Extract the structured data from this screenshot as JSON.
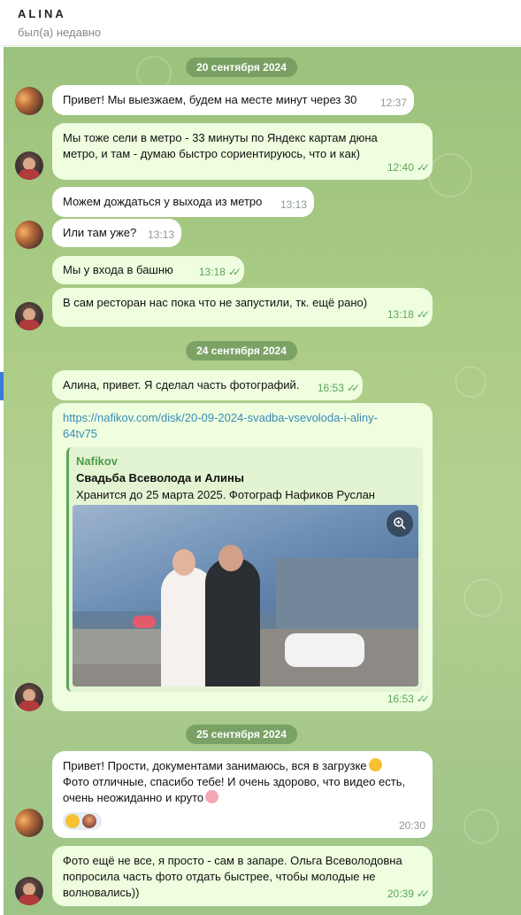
{
  "header": {
    "title": "ALINA",
    "status": "был(а) недавно"
  },
  "dates": [
    "20 сентября 2024",
    "24 сентября 2024",
    "25 сентября 2024"
  ],
  "messages": [
    {
      "text": "Привет! Мы выезжаем, будем на месте минут через  30",
      "time": "12:37"
    },
    {
      "text": "Мы тоже сели в метро - 33 минуты по Яндекс картам дюна метро, и там - думаю быстро сориентируюсь, что и как)",
      "time": "12:40"
    },
    {
      "text": "Можем дождаться у выхода из метро",
      "time": "13:13"
    },
    {
      "text": "Или там уже?",
      "time": "13:13"
    },
    {
      "text": "Мы у входа в башню",
      "time": "13:18"
    },
    {
      "text": "В сам ресторан нас пока что не запустили, тк. ещё рано)",
      "time": "13:18"
    },
    {
      "text": "Алина, привет. Я сделал часть фотографий.",
      "time": "16:53"
    },
    {
      "text": "https://nafikov.com/disk/20-09-2024-svadba-vsevoloda-i-aliny-64tv75",
      "time": "16:53"
    },
    {
      "text": "Привет! Прости, документами занимаюсь, вся в загрузке",
      "text2": "Фото отличные, спасибо тебе! И очень здорово, что видео есть, очень неожиданно и круто",
      "time": "20:30"
    },
    {
      "text": "Фото ещё не все, я просто - сам в запаре. Ольга Всеволодовна попросила часть фото отдать быстрее, чтобы молодые не волновались))",
      "time": "20:39"
    }
  ],
  "link_preview": {
    "site": "Nafikov",
    "title": "Свадьба Всеволода и Алины",
    "description": "Хранится до 25 марта 2025. Фотограф Нафиков Руслан"
  },
  "icons": {
    "read": "double-check-icon",
    "zoom": "zoom-in-icon"
  },
  "colors": {
    "outgoing_bubble": "#eefedf",
    "incoming_bubble": "#ffffff",
    "accent": "#5ea45a",
    "link": "#3a8ab5"
  }
}
